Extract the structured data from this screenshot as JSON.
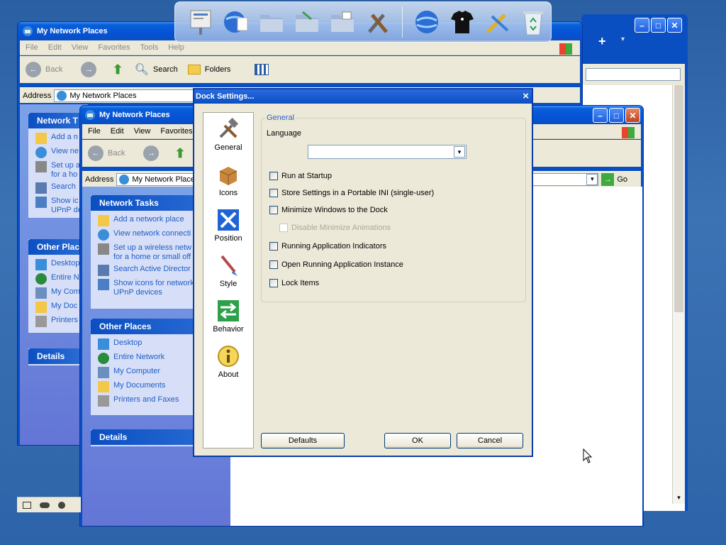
{
  "back_window": {
    "title": "My Network Places",
    "menu": [
      "File",
      "Edit",
      "View",
      "Favorites",
      "Tools",
      "Help"
    ],
    "toolbar": {
      "back": "Back",
      "search": "Search",
      "folders": "Folders"
    },
    "address_label": "Address",
    "address_value": "My Network Places",
    "go": "Go",
    "network_tasks": {
      "title": "Network T",
      "items": [
        "Add a n",
        "View ne",
        "Set up a\nfor a ho",
        "Search",
        "Show ic\nUPnP de"
      ]
    },
    "other_places": {
      "title": "Other Plac",
      "items": [
        "Desktop",
        "Entire N",
        "My Com",
        "My Doc",
        "Printers"
      ]
    },
    "details": "Details"
  },
  "mid_window": {
    "title": "My Network Places",
    "menu": [
      "File",
      "Edit",
      "View",
      "Favorites"
    ],
    "toolbar": {
      "back": "Back"
    },
    "address_label": "Address",
    "address_value": "My Network Place",
    "go": "Go",
    "network_tasks": {
      "title": "Network Tasks",
      "items": [
        "Add a network place",
        "View network connecti",
        "Set up a wireless netw\nfor a home or small off",
        "Search Active Director",
        "Show icons for network\nUPnP devices"
      ]
    },
    "other_places": {
      "title": "Other Places",
      "items": [
        "Desktop",
        "Entire Network",
        "My Computer",
        "My Documents",
        "Printers and Faxes"
      ]
    },
    "details": "Details"
  },
  "dialog": {
    "title": "Dock Settings...",
    "close": "×",
    "nav": [
      {
        "label": "General",
        "icon": "tools-icon"
      },
      {
        "label": "Icons",
        "icon": "box-icon"
      },
      {
        "label": "Position",
        "icon": "position-arrows-icon"
      },
      {
        "label": "Style",
        "icon": "brush-icon"
      },
      {
        "label": "Behavior",
        "icon": "behavior-arrows-icon"
      },
      {
        "label": "About",
        "icon": "info-icon"
      }
    ],
    "group_title": "General",
    "language_label": "Language",
    "language_value": "",
    "options": [
      {
        "label": "Run at Startup",
        "checked": false,
        "enabled": true
      },
      {
        "label": "Store Settings in a Portable INI (single-user)",
        "checked": false,
        "enabled": true
      },
      {
        "label": "Minimize Windows to the Dock",
        "checked": false,
        "enabled": true
      },
      {
        "label": "Disable Minimize Animations",
        "checked": false,
        "enabled": false
      },
      {
        "label": "Running Application Indicators",
        "checked": false,
        "enabled": true
      },
      {
        "label": "Open Running Application Instance",
        "checked": false,
        "enabled": true
      },
      {
        "label": "Lock Items",
        "checked": false,
        "enabled": true
      }
    ],
    "buttons": {
      "defaults": "Defaults",
      "ok": "OK",
      "cancel": "Cancel"
    }
  },
  "dock_items": [
    "presentation-icon",
    "globe-document-icon",
    "folder-icon",
    "folder-icon",
    "folder-icon",
    "tools-icon",
    "globe-icon",
    "tshirt-icon",
    "settings-tools-icon",
    "recycle-bin-icon"
  ],
  "colors": {
    "xp_blue": "#0a4fc2",
    "dialog_bg": "#ece9d8",
    "link": "#215dc6"
  }
}
